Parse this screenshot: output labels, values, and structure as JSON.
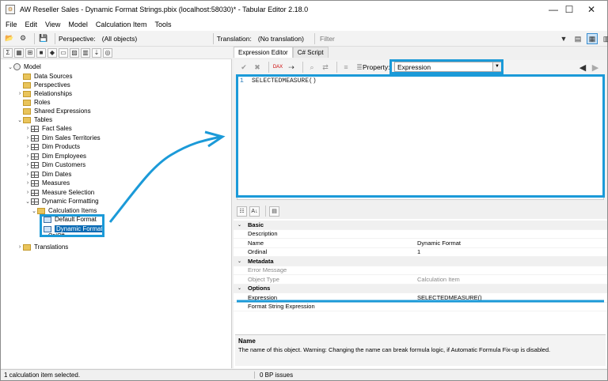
{
  "window": {
    "title": "AW Reseller Sales - Dynamic Format Strings.pbix (localhost:58030)* - Tabular Editor 2.18.0"
  },
  "menu": [
    "File",
    "Edit",
    "View",
    "Model",
    "Calculation Item",
    "Tools"
  ],
  "toolbar": {
    "perspective_label": "Perspective:",
    "perspective_value": "(All objects)",
    "translation_label": "Translation:",
    "translation_value": "(No translation)",
    "filter_placeholder": "Filter"
  },
  "tree": {
    "model": "Model",
    "items": [
      "Data Sources",
      "Perspectives",
      "Relationships",
      "Roles",
      "Shared Expressions"
    ],
    "tables_label": "Tables",
    "tables": [
      "Fact Sales",
      "Dim Sales Territories",
      "Dim Products",
      "Dim Employees",
      "Dim Customers",
      "Dim Dates",
      "Measures",
      "Measure Selection",
      "Dynamic Formatting"
    ],
    "calc_items_label": "Calculation Items",
    "calc_items": [
      "Default Format",
      "Dynamic Format"
    ],
    "hidden_item": "On/Off",
    "translations": "Translations"
  },
  "editor": {
    "tab_active": "Expression Editor",
    "tab_other": "C# Script",
    "property_label": "Property:",
    "property_value": "Expression",
    "line_number": "1",
    "code": "SELECTEDMEASURE()"
  },
  "properties": {
    "categories": [
      "Basic",
      "Metadata",
      "Options"
    ],
    "rows": {
      "description": "Description",
      "name": "Name",
      "name_value": "Dynamic Format",
      "ordinal": "Ordinal",
      "ordinal_value": "1",
      "error_message": "Error Message",
      "object_type": "Object Type",
      "object_type_value": "Calculation Item",
      "expression": "Expression",
      "expression_value": "SELECTEDMEASURE()",
      "format_string": "Format String Expression"
    },
    "desc_title": "Name",
    "desc_text": "The name of this object. Warning: Changing the name can break formula logic, if Automatic Formula Fix-up is disabled."
  },
  "status": {
    "left": "1 calculation item selected.",
    "right": "0 BP issues"
  },
  "colors": {
    "highlight": "#1b9ad8",
    "selection": "#0c6bb4"
  }
}
